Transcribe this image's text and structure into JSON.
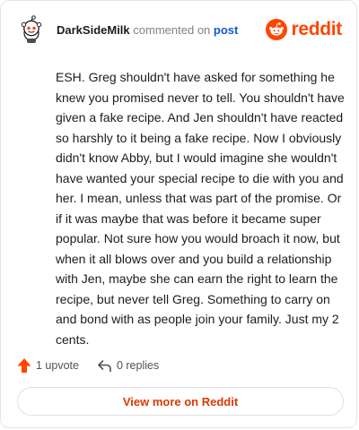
{
  "header": {
    "username": "DarkSideMilk",
    "action_text": "commented on",
    "post_link": "post",
    "brand": "reddit",
    "avatar_icon": "snoo-avatar-icon",
    "logo_icon": "reddit-logo-icon"
  },
  "comment": {
    "body": "ESH. Greg shouldn't have asked for something he knew you promised never to tell. You shouldn't have given a fake recipe. And Jen shouldn't have reacted so harshly to it being a fake recipe. Now I obviously didn't know Abby, but I would imagine she wouldn't have wanted your special recipe to die with you and her. I mean, unless that was part of the promise. Or if it was maybe that was before it became super popular. Not sure how you would broach it now, but when it all blows over and you build a relationship with Jen, maybe she can earn the right to learn the recipe, but never tell Greg. Something to carry on and bond with as people join your family. Just my 2 cents."
  },
  "actions": {
    "upvote_label": "1 upvote",
    "replies_label": "0 replies",
    "upvote_icon": "upvote-arrow-icon",
    "reply_icon": "reply-arrow-icon"
  },
  "footer": {
    "view_more_label": "View more on Reddit"
  },
  "colors": {
    "brand": "#ff4500",
    "link": "#0f5bd1",
    "view_more_text": "#d93a00"
  }
}
